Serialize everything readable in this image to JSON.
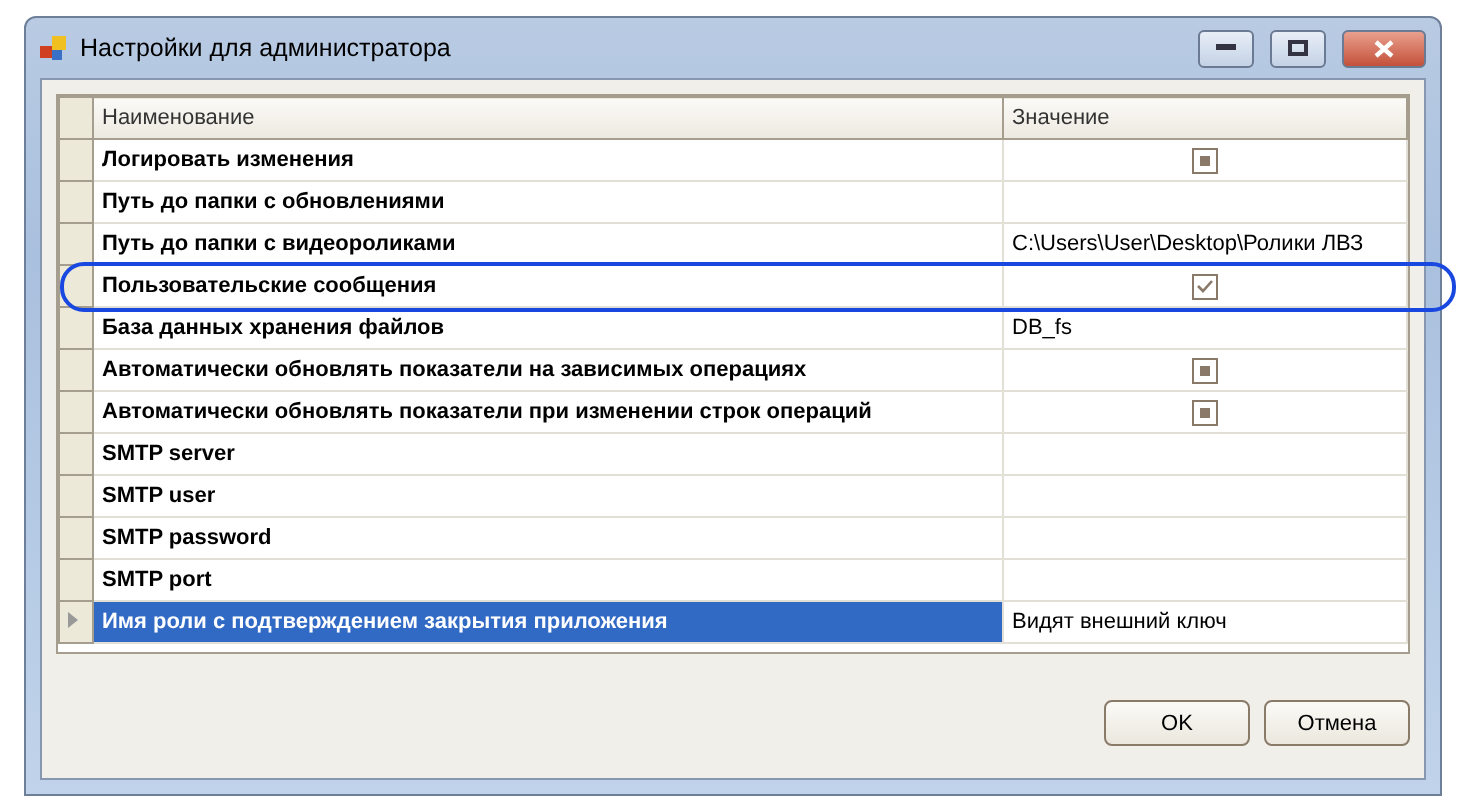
{
  "window": {
    "title": "Настройки для администратора"
  },
  "grid": {
    "columns": [
      "Наименование",
      "Значение"
    ],
    "rows": [
      {
        "name": "Логировать изменения",
        "kind": "checkbox",
        "indeterminate": true,
        "selected": false,
        "highlighted": false
      },
      {
        "name": "Путь до папки с обновлениями",
        "kind": "text",
        "value": "",
        "selected": false,
        "highlighted": false
      },
      {
        "name": "Путь до папки с видеороликами",
        "kind": "text",
        "value": "C:\\Users\\User\\Desktop\\Ролики ЛВЗ",
        "selected": false,
        "highlighted": false
      },
      {
        "name": "Пользовательские сообщения",
        "kind": "checkbox",
        "checked": true,
        "selected": false,
        "highlighted": true
      },
      {
        "name": "База данных хранения файлов",
        "kind": "text",
        "value": "DB_fs",
        "selected": false,
        "highlighted": false
      },
      {
        "name": "Автоматически обновлять показатели на зависимых операциях",
        "kind": "checkbox",
        "indeterminate": true,
        "selected": false,
        "highlighted": false
      },
      {
        "name": "Автоматически обновлять показатели при изменении строк операций",
        "kind": "checkbox",
        "indeterminate": true,
        "selected": false,
        "highlighted": false
      },
      {
        "name": "SMTP server",
        "kind": "text",
        "value": "",
        "selected": false,
        "highlighted": false
      },
      {
        "name": "SMTP user",
        "kind": "text",
        "value": "",
        "selected": false,
        "highlighted": false
      },
      {
        "name": "SMTP password",
        "kind": "text",
        "value": "",
        "selected": false,
        "highlighted": false
      },
      {
        "name": "SMTP port",
        "kind": "text",
        "value": "",
        "selected": false,
        "highlighted": false
      },
      {
        "name": "Имя роли с подтверждением закрытия приложения",
        "kind": "text",
        "value": "Видят внешний ключ",
        "selected": true,
        "highlighted": false
      }
    ]
  },
  "buttons": [
    "OK",
    "Отмена"
  ]
}
